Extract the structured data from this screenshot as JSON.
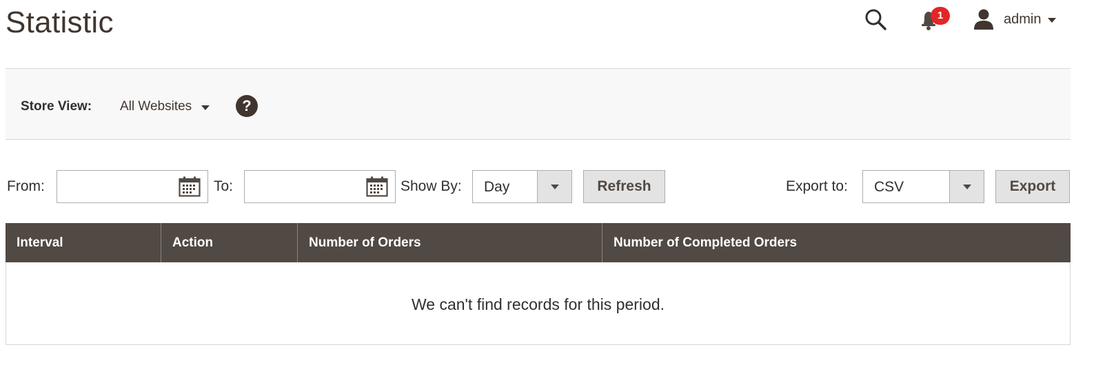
{
  "page": {
    "title": "Statistic"
  },
  "header": {
    "search_icon": "search-icon",
    "notifications": {
      "icon": "bell-icon",
      "count": "1"
    },
    "user": {
      "icon": "user-icon",
      "name": "admin"
    }
  },
  "store_view": {
    "label": "Store View:",
    "selected": "All Websites",
    "help_icon": "help-icon",
    "help_glyph": "?"
  },
  "filters": {
    "from_label": "From:",
    "from_value": "",
    "to_label": "To:",
    "to_value": "",
    "show_by_label": "Show By:",
    "show_by_value": "Day",
    "refresh_label": "Refresh",
    "export_label": "Export to:",
    "export_format": "CSV",
    "export_button": "Export"
  },
  "grid": {
    "columns": [
      "Interval",
      "Action",
      "Number of Orders",
      "Number of Completed Orders"
    ],
    "empty_message": "We can't find records for this period."
  },
  "colors": {
    "header_bg": "#514943",
    "badge": "#e22626",
    "text_dark": "#41362f"
  }
}
